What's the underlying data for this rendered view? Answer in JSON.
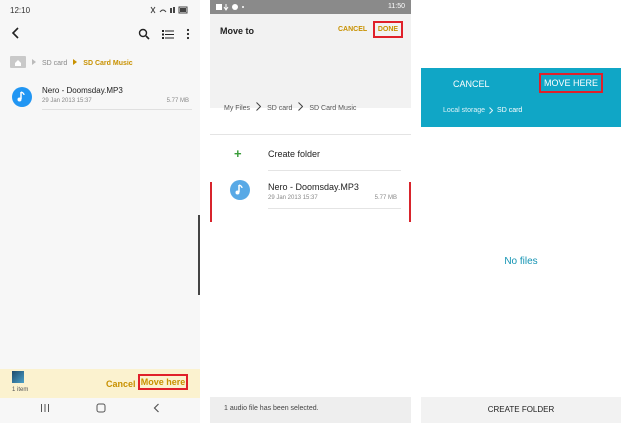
{
  "panel1": {
    "status": {
      "time": "12:10"
    },
    "breadcrumb": {
      "root": "SD card",
      "current": "SD Card Music"
    },
    "file": {
      "name": "Nero - Doomsday.MP3",
      "date": "29 Jan 2013 15:37",
      "size": "5.77 MB"
    },
    "bottom": {
      "count": "1 item",
      "cancel": "Cancel",
      "move_here": "Move here"
    }
  },
  "panel2": {
    "status": {
      "time": "11:50"
    },
    "title": "Move to",
    "cancel": "CANCEL",
    "done": "DONE",
    "breadcrumb": {
      "a": "My Files",
      "b": "SD card",
      "c": "SD Card Music"
    },
    "create_folder": "Create folder",
    "file": {
      "name": "Nero - Doomsday.MP3",
      "date": "29 Jan 2013 15:37",
      "size": "5.77 MB"
    },
    "footer": "1 audio file has been selected."
  },
  "panel3": {
    "cancel": "CANCEL",
    "move_here": "MOVE HERE",
    "breadcrumb": {
      "a": "Local storage",
      "b": "SD card"
    },
    "empty": "No files",
    "footer": "CREATE FOLDER"
  },
  "colors": {
    "gold": "#c89100",
    "teal": "#10a6c6",
    "highlight": "#e0202a"
  }
}
